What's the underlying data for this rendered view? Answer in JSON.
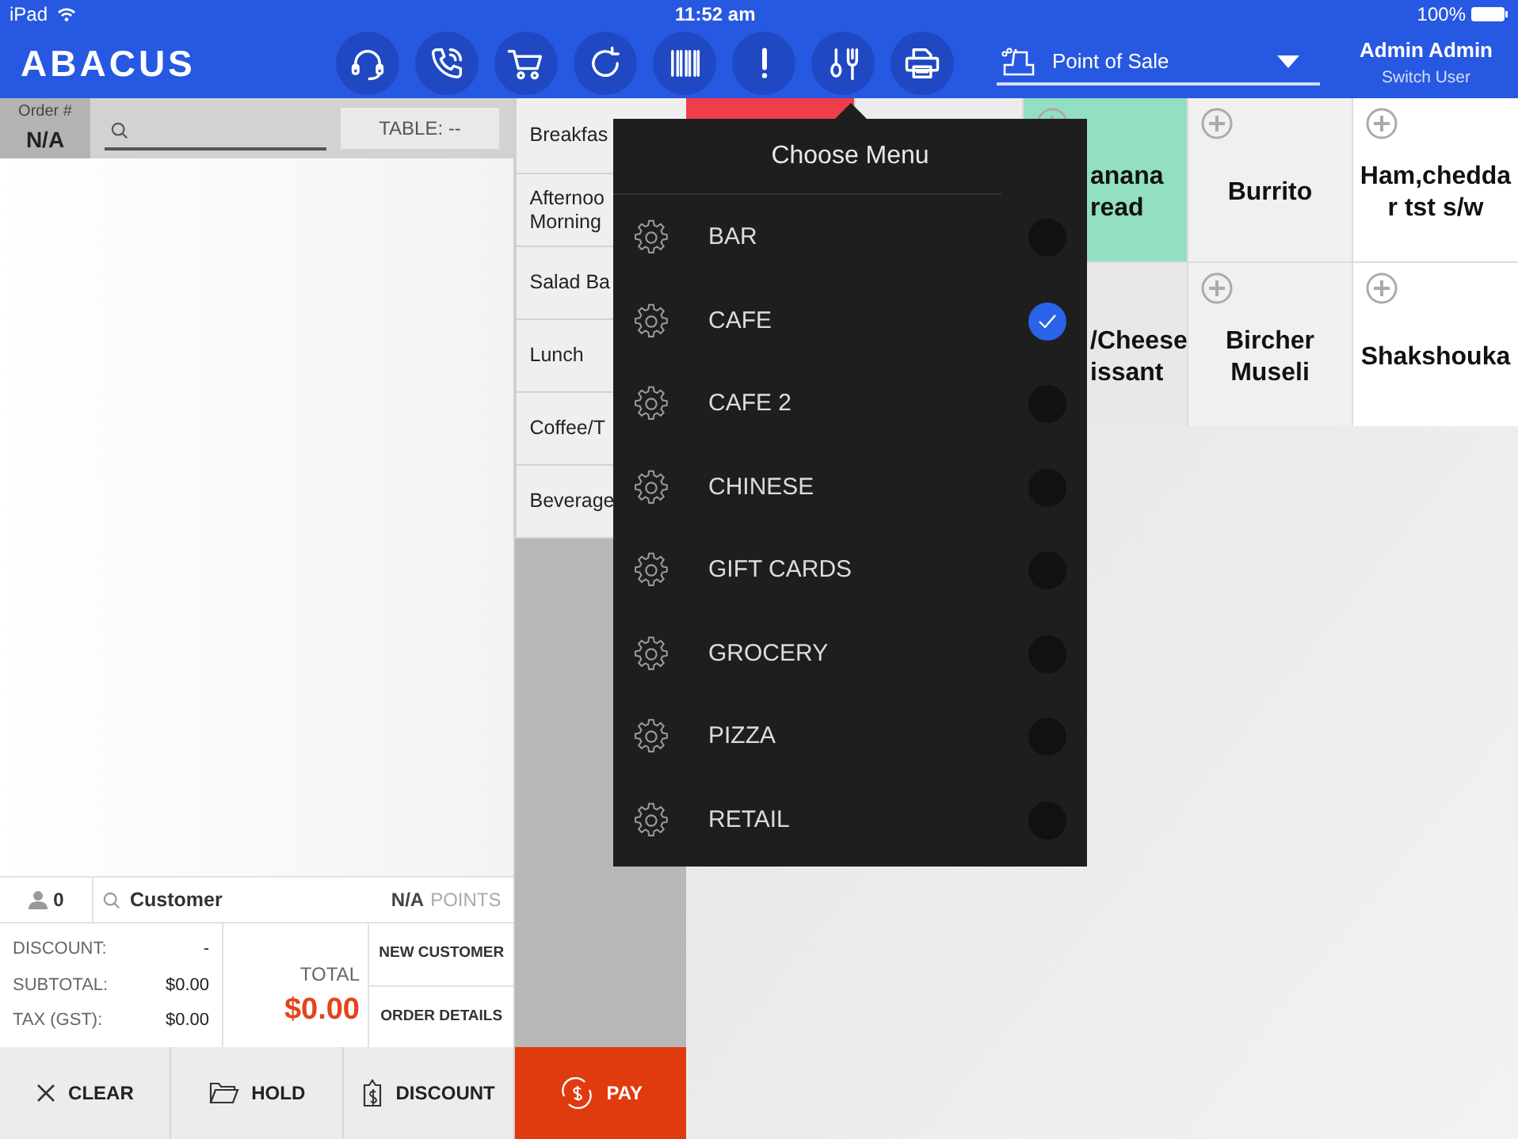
{
  "status_bar": {
    "device": "iPad",
    "time": "11:52 am",
    "battery": "100%"
  },
  "header": {
    "logo": "ABACUS",
    "mode": "Point of Sale",
    "user": "Admin Admin",
    "switch_user": "Switch User"
  },
  "order": {
    "label": "Order #",
    "number": "N/A",
    "table": "TABLE: --"
  },
  "customer_bar": {
    "guests": "0",
    "customer": "Customer",
    "points_value": "N/A",
    "points_label": "POINTS"
  },
  "totals": {
    "rows": [
      {
        "label": "DISCOUNT:",
        "value": "-"
      },
      {
        "label": "SUBTOTAL:",
        "value": "$0.00"
      },
      {
        "label": "TAX (GST):",
        "value": "$0.00"
      }
    ],
    "total_label": "TOTAL",
    "total": "$0.00"
  },
  "side_buttons": [
    "NEW CUSTOMER",
    "ORDER DETAILS"
  ],
  "actions": [
    {
      "kind": "clear",
      "label": "CLEAR"
    },
    {
      "kind": "hold",
      "label": "HOLD"
    },
    {
      "kind": "discount",
      "label": "DISCOUNT"
    },
    {
      "kind": "pay",
      "label": "PAY"
    }
  ],
  "categories": [
    {
      "lines": [
        "Breakfas"
      ]
    },
    {
      "lines": [
        "Afternoo",
        "Morning"
      ]
    },
    {
      "lines": [
        "Salad Ba"
      ]
    },
    {
      "lines": [
        "Lunch"
      ]
    },
    {
      "lines": [
        "Coffee/T"
      ]
    },
    {
      "lines": [
        "Beverage"
      ]
    }
  ],
  "products": [
    {
      "color": "#ee3d4b"
    },
    {
      "color": "#ececec"
    },
    {
      "color": "#92dfc2",
      "lines": [
        "anana",
        "read"
      ]
    },
    {
      "color": "#f0f0f0",
      "lines": [
        "Burrito"
      ]
    },
    {
      "color": "#ffffff",
      "lines": [
        "Ham,chedda",
        "r tst s/w"
      ]
    },
    {
      "color": "#e8e8e8",
      "lines": [
        "/Cheese",
        "issant"
      ]
    },
    {
      "color": "#f0f0f0",
      "lines": [
        "Bircher",
        "Museli"
      ]
    },
    {
      "color": "#ffffff",
      "lines": [
        "Shakshouka"
      ]
    }
  ],
  "menu_popover": {
    "title": "Choose Menu",
    "items": [
      {
        "label": "BAR",
        "selected": false
      },
      {
        "label": "CAFE",
        "selected": true
      },
      {
        "label": "CAFE 2",
        "selected": false
      },
      {
        "label": "CHINESE",
        "selected": false
      },
      {
        "label": "GIFT CARDS",
        "selected": false
      },
      {
        "label": "GROCERY",
        "selected": false
      },
      {
        "label": "PIZZA",
        "selected": false
      },
      {
        "label": "RETAIL",
        "selected": false
      }
    ]
  }
}
